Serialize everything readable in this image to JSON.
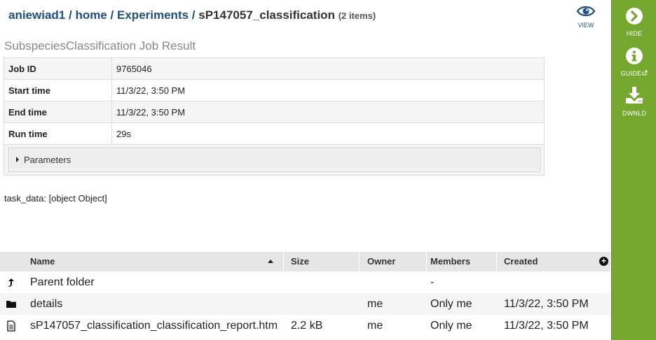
{
  "breadcrumb": {
    "user": "aniewiad1",
    "home": "home",
    "experiments": "Experiments",
    "current": "sP147057_classification",
    "count": "(2 items)",
    "sep": "/"
  },
  "view_button": {
    "icon": "eye-icon",
    "label": "VIEW"
  },
  "job_result": {
    "title": "SubspeciesClassification Job Result",
    "rows": [
      {
        "key": "Job ID",
        "value": "9765046"
      },
      {
        "key": "Start time",
        "value": "11/3/22, 3:50 PM"
      },
      {
        "key": "End time",
        "value": "11/3/22, 3:50 PM"
      },
      {
        "key": "Run time",
        "value": "29s"
      }
    ],
    "parameters_label": "Parameters"
  },
  "task_data": "task_data: [object Object]",
  "grid": {
    "columns": [
      "Name",
      "Size",
      "Owner",
      "Members",
      "Created"
    ],
    "rows": [
      {
        "icon": "arrow-up-icon",
        "name": "Parent folder",
        "size": "",
        "owner": "",
        "members": "-",
        "created": ""
      },
      {
        "icon": "folder-icon",
        "name": "details",
        "size": "",
        "owner": "me",
        "members": "Only me",
        "created": "11/3/22, 3:50 PM"
      },
      {
        "icon": "file-icon",
        "name": "sP147057_classification_classification_report.htm",
        "size": "2.2 kB",
        "owner": "me",
        "members": "Only me",
        "created": "11/3/22, 3:50 PM"
      }
    ]
  },
  "sidebar": {
    "color": "#76a82f",
    "items": [
      {
        "icon": "chevron-right-circle-icon",
        "label": "HIDE"
      },
      {
        "icon": "info-icon",
        "label": "GUIDE"
      },
      {
        "icon": "download-icon",
        "label": "DWNLD"
      }
    ]
  }
}
